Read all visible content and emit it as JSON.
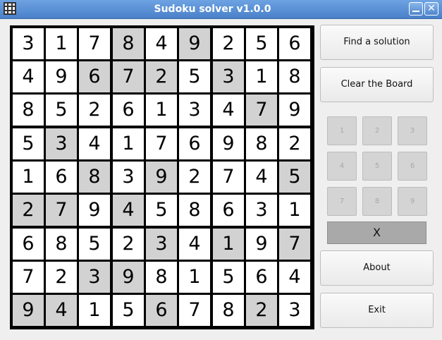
{
  "window": {
    "title": "Sudoku solver v1.0.0",
    "minimize_icon": "minimize-icon",
    "close_icon": "close-icon",
    "close_glyph": "✕"
  },
  "board": {
    "rows": [
      [
        3,
        1,
        7,
        8,
        4,
        9,
        2,
        5,
        6
      ],
      [
        4,
        9,
        6,
        7,
        2,
        5,
        3,
        1,
        8
      ],
      [
        8,
        5,
        2,
        6,
        1,
        3,
        4,
        7,
        9
      ],
      [
        5,
        3,
        4,
        1,
        7,
        6,
        9,
        8,
        2
      ],
      [
        1,
        6,
        8,
        3,
        9,
        2,
        7,
        4,
        5
      ],
      [
        2,
        7,
        9,
        4,
        5,
        8,
        6,
        3,
        1
      ],
      [
        6,
        8,
        5,
        2,
        3,
        4,
        1,
        9,
        7
      ],
      [
        7,
        2,
        3,
        9,
        8,
        1,
        5,
        6,
        4
      ],
      [
        9,
        4,
        1,
        5,
        6,
        7,
        8,
        2,
        3
      ]
    ],
    "given": [
      [
        0,
        0,
        0,
        1,
        0,
        1,
        0,
        0,
        0
      ],
      [
        0,
        0,
        1,
        1,
        1,
        0,
        1,
        0,
        0
      ],
      [
        0,
        0,
        0,
        0,
        0,
        0,
        0,
        1,
        0
      ],
      [
        0,
        1,
        0,
        0,
        0,
        0,
        0,
        0,
        0
      ],
      [
        0,
        0,
        1,
        0,
        1,
        0,
        0,
        0,
        1
      ],
      [
        1,
        1,
        0,
        1,
        0,
        0,
        0,
        0,
        0
      ],
      [
        0,
        0,
        0,
        0,
        1,
        0,
        1,
        0,
        1
      ],
      [
        0,
        0,
        1,
        1,
        0,
        0,
        0,
        0,
        0
      ],
      [
        1,
        1,
        0,
        0,
        1,
        0,
        0,
        1,
        0
      ]
    ]
  },
  "buttons": {
    "find": "Find a solution",
    "clear": "Clear the Board",
    "about": "About",
    "exit": "Exit"
  },
  "numpad": [
    "1",
    "2",
    "3",
    "4",
    "5",
    "6",
    "7",
    "8",
    "9"
  ],
  "clear_cell": "X"
}
